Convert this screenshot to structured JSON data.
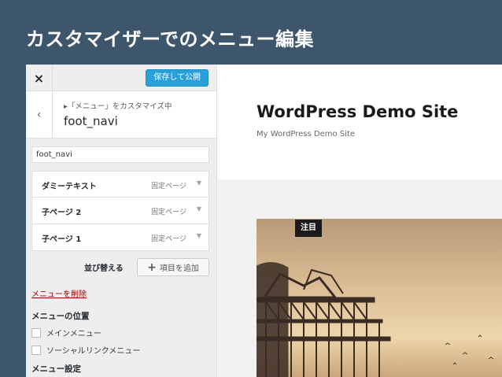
{
  "slide": {
    "title": "カスタマイザーでのメニュー編集"
  },
  "panel": {
    "close_icon": "×",
    "save_label": "保存して公開",
    "back_icon": "‹",
    "crumb": "▸「メニュー」をカスタマイズ中",
    "section_title": "foot_navi",
    "menu_name_value": "foot_navi",
    "items": [
      {
        "title": "ダミーテキスト",
        "type": "固定ページ",
        "arrow": "▼"
      },
      {
        "title": "子ページ 2",
        "type": "固定ページ",
        "arrow": "▼"
      },
      {
        "title": "子ページ 1",
        "type": "固定ページ",
        "arrow": "▼"
      }
    ],
    "reorder_label": "並び替える",
    "add_icon": "+",
    "add_label": "項目を追加",
    "delete_label": "メニューを削除",
    "locations_title": "メニューの位置",
    "locations": [
      {
        "label": "メインメニュー",
        "checked": false
      },
      {
        "label": "ソーシャルリンクメニュー",
        "checked": false
      }
    ],
    "settings_title": "メニュー設定"
  },
  "preview": {
    "site_title": "WordPress Demo Site",
    "site_desc": "My WordPress Demo Site",
    "sticky_label": "注目"
  },
  "colors": {
    "background": "#3e566b",
    "save_button": "#2aa0d8",
    "delete_link": "#a00000"
  }
}
